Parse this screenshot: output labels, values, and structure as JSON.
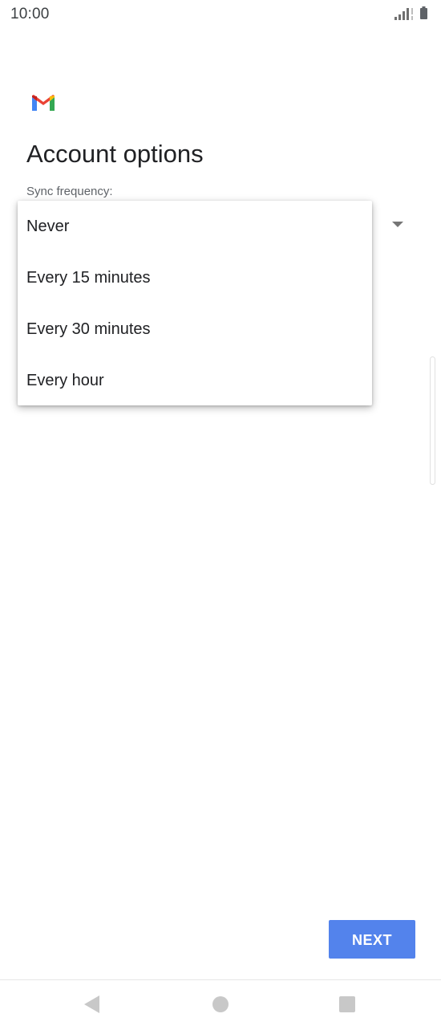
{
  "status_bar": {
    "time": "10:00",
    "icons": [
      "signal-icon",
      "battery-icon"
    ]
  },
  "app": {
    "logo": "gmail-logo-icon",
    "colors": {
      "red": "#ea4335",
      "blue": "#4285f4",
      "green": "#34a853",
      "yellow": "#fbbc04",
      "darkred": "#c5221f"
    }
  },
  "page": {
    "title": "Account options",
    "sync_label": "Sync frequency:"
  },
  "dropdown": {
    "options": [
      "Never",
      "Every 15 minutes",
      "Every 30 minutes",
      "Every hour"
    ]
  },
  "footer": {
    "next_label": "NEXT",
    "accent": "#5383ec"
  },
  "nav": {
    "icons": [
      "back-icon",
      "home-icon",
      "recents-icon"
    ]
  }
}
